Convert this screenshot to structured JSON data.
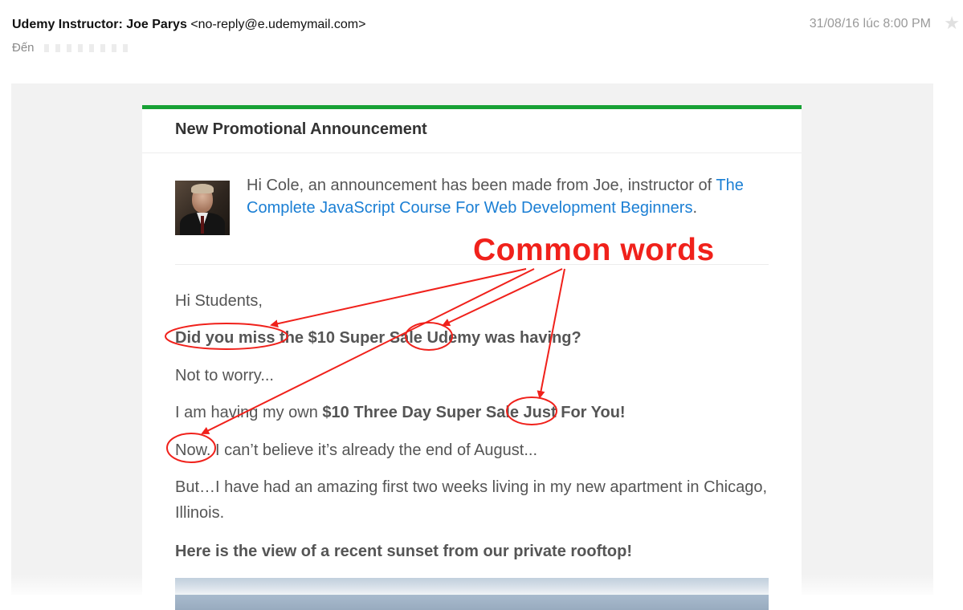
{
  "header": {
    "sender_name": "Udemy Instructor: Joe Parys",
    "sender_email": "<no-reply@e.udemymail.com>",
    "to_label": "Đến",
    "date": "31/08/16 lúc 8:00 PM",
    "star_icon": "star-icon"
  },
  "email": {
    "title": "New Promotional Announcement",
    "accent_color": "#17a135",
    "link_color": "#1b7fd4",
    "intro_text": "Hi Cole, an announcement has been made from Joe, instructor of",
    "course_link": "The Complete JavaScript Course For Web Development Beginners",
    "intro_period": ".",
    "greeting": "Hi Students,",
    "line1": "Did you miss the $10 Super Sale Udemy was having?",
    "line2": "Not to worry...",
    "line3_prefix": "I am having my own ",
    "line3_bold": "$10 Three Day Super Sale Just For You!",
    "line4": "Now. I can’t believe it’s already the end of August...",
    "line5": "But…I have had an amazing first two weeks living in my new apartment in Chicago, Illinois.",
    "line6": "Here is the view of a recent sunset from our private rooftop!"
  },
  "annotation": {
    "label": "Common words",
    "color": "#f0211b",
    "circled_words": [
      "Did you miss",
      "Sale",
      "Sale",
      "Now."
    ]
  }
}
